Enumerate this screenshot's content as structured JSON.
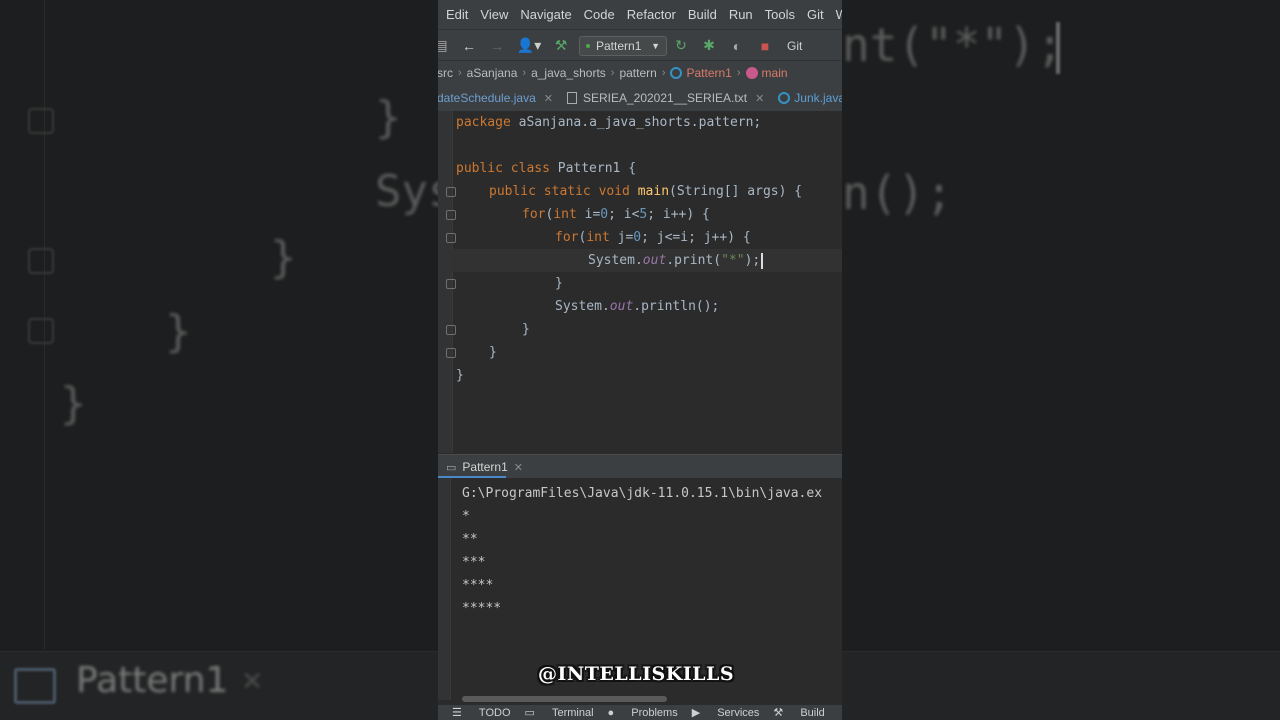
{
  "menu": [
    "Edit",
    "View",
    "Navigate",
    "Code",
    "Refactor",
    "Build",
    "Run",
    "Tools",
    "Git",
    "Wi"
  ],
  "toolbar": {
    "run_config": "Pattern1",
    "git_label": "Git"
  },
  "breadcrumb": [
    "src",
    "aSanjana",
    "a_java_shorts",
    "pattern",
    "Pattern1",
    "main"
  ],
  "tabs": [
    {
      "label": "dateSchedule.java",
      "active": false
    },
    {
      "label": "SERIEA_202021__SERIEA.txt",
      "active": false
    },
    {
      "label": "Junk.java",
      "active": true
    }
  ],
  "code_lines": {
    "l1_kw": "package",
    "l1_rest": " aSanjana.a_java_shorts.pattern;",
    "l3_kw": "public class",
    "l3_rest": " Pattern1 {",
    "l4_kw": "public static void",
    "l4_fn": "main",
    "l4_rest": "(String[] args) {",
    "l5_kw": "for",
    "l5_open": "(",
    "l5_int": "int",
    "l5_a": " i=",
    "l5_n0": "0",
    "l5_b": "; i<",
    "l5_n5": "5",
    "l5_c": "; i++) {",
    "l6_kw": "for",
    "l6_open": "(",
    "l6_int": "int",
    "l6_a": " j=",
    "l6_n0": "0",
    "l6_b": "; j<=i; j++) {",
    "l7_a": "System.",
    "l7_out": "out",
    "l7_b": ".print(",
    "l7_str": "\"*\"",
    "l7_c": ");",
    "l8": "}",
    "l9_a": "System.",
    "l9_out": "out",
    "l9_b": ".println();",
    "l10": "}",
    "l11": "}",
    "l12": "}"
  },
  "run_panel": {
    "tab_label": "Pattern1",
    "output": [
      "G:\\ProgramFiles\\Java\\jdk-11.0.15.1\\bin\\java.ex",
      "*",
      "**",
      "***",
      "****",
      "*****"
    ]
  },
  "watermark": "@INTELLISKILLS",
  "statusbar": [
    "TODO",
    "Terminal",
    "Problems",
    "Services",
    "Build"
  ],
  "background": {
    "code_right_top": "nt(\"*\");",
    "code_left_mid": "Sys",
    "code_right_mid": "n();",
    "bottom_tab": "Pattern1"
  },
  "colors": {
    "editor_bg": "#2b2b2b",
    "panel_bg": "#3c3f41",
    "keyword": "#cc7832",
    "function": "#ffc66d",
    "number": "#6897bb",
    "string": "#6a8759",
    "field": "#9876aa"
  }
}
